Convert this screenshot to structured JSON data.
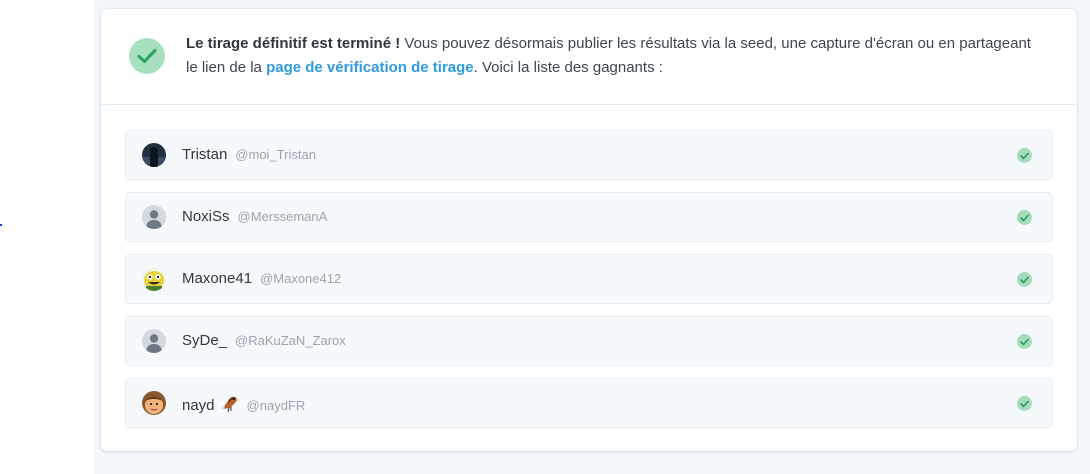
{
  "notice": {
    "title": "Le tirage définitif est terminé !",
    "text_before_link": " Vous pouvez désormais publier les résultats via la seed, une capture d'écran ou en partageant le lien de la ",
    "link_label": "page de vérification de tirage",
    "text_after_link": ". Voici la liste des gagnants :",
    "icon": "check-circle-icon"
  },
  "winners": [
    {
      "name": "Tristan",
      "handle": "@moi_Tristan",
      "avatar": "photo-dark"
    },
    {
      "name": "NoxiSs",
      "handle": "@MerssemanA",
      "avatar": "default-user"
    },
    {
      "name": "Maxone41",
      "handle": "@Maxone412",
      "avatar": "cartoon-yellow"
    },
    {
      "name": "SyDe_",
      "handle": "@RaKuZaN_Zarox",
      "avatar": "default-user"
    },
    {
      "name": "nayd",
      "handle": "@naydFR",
      "avatar": "cartoon-face",
      "emoji": "bird-emoji"
    }
  ],
  "colors": {
    "accent_link": "#2f9be0",
    "success_green": "#4caf7a",
    "success_bg": "#a8dfbf",
    "page_bg": "#f2f7fc"
  }
}
